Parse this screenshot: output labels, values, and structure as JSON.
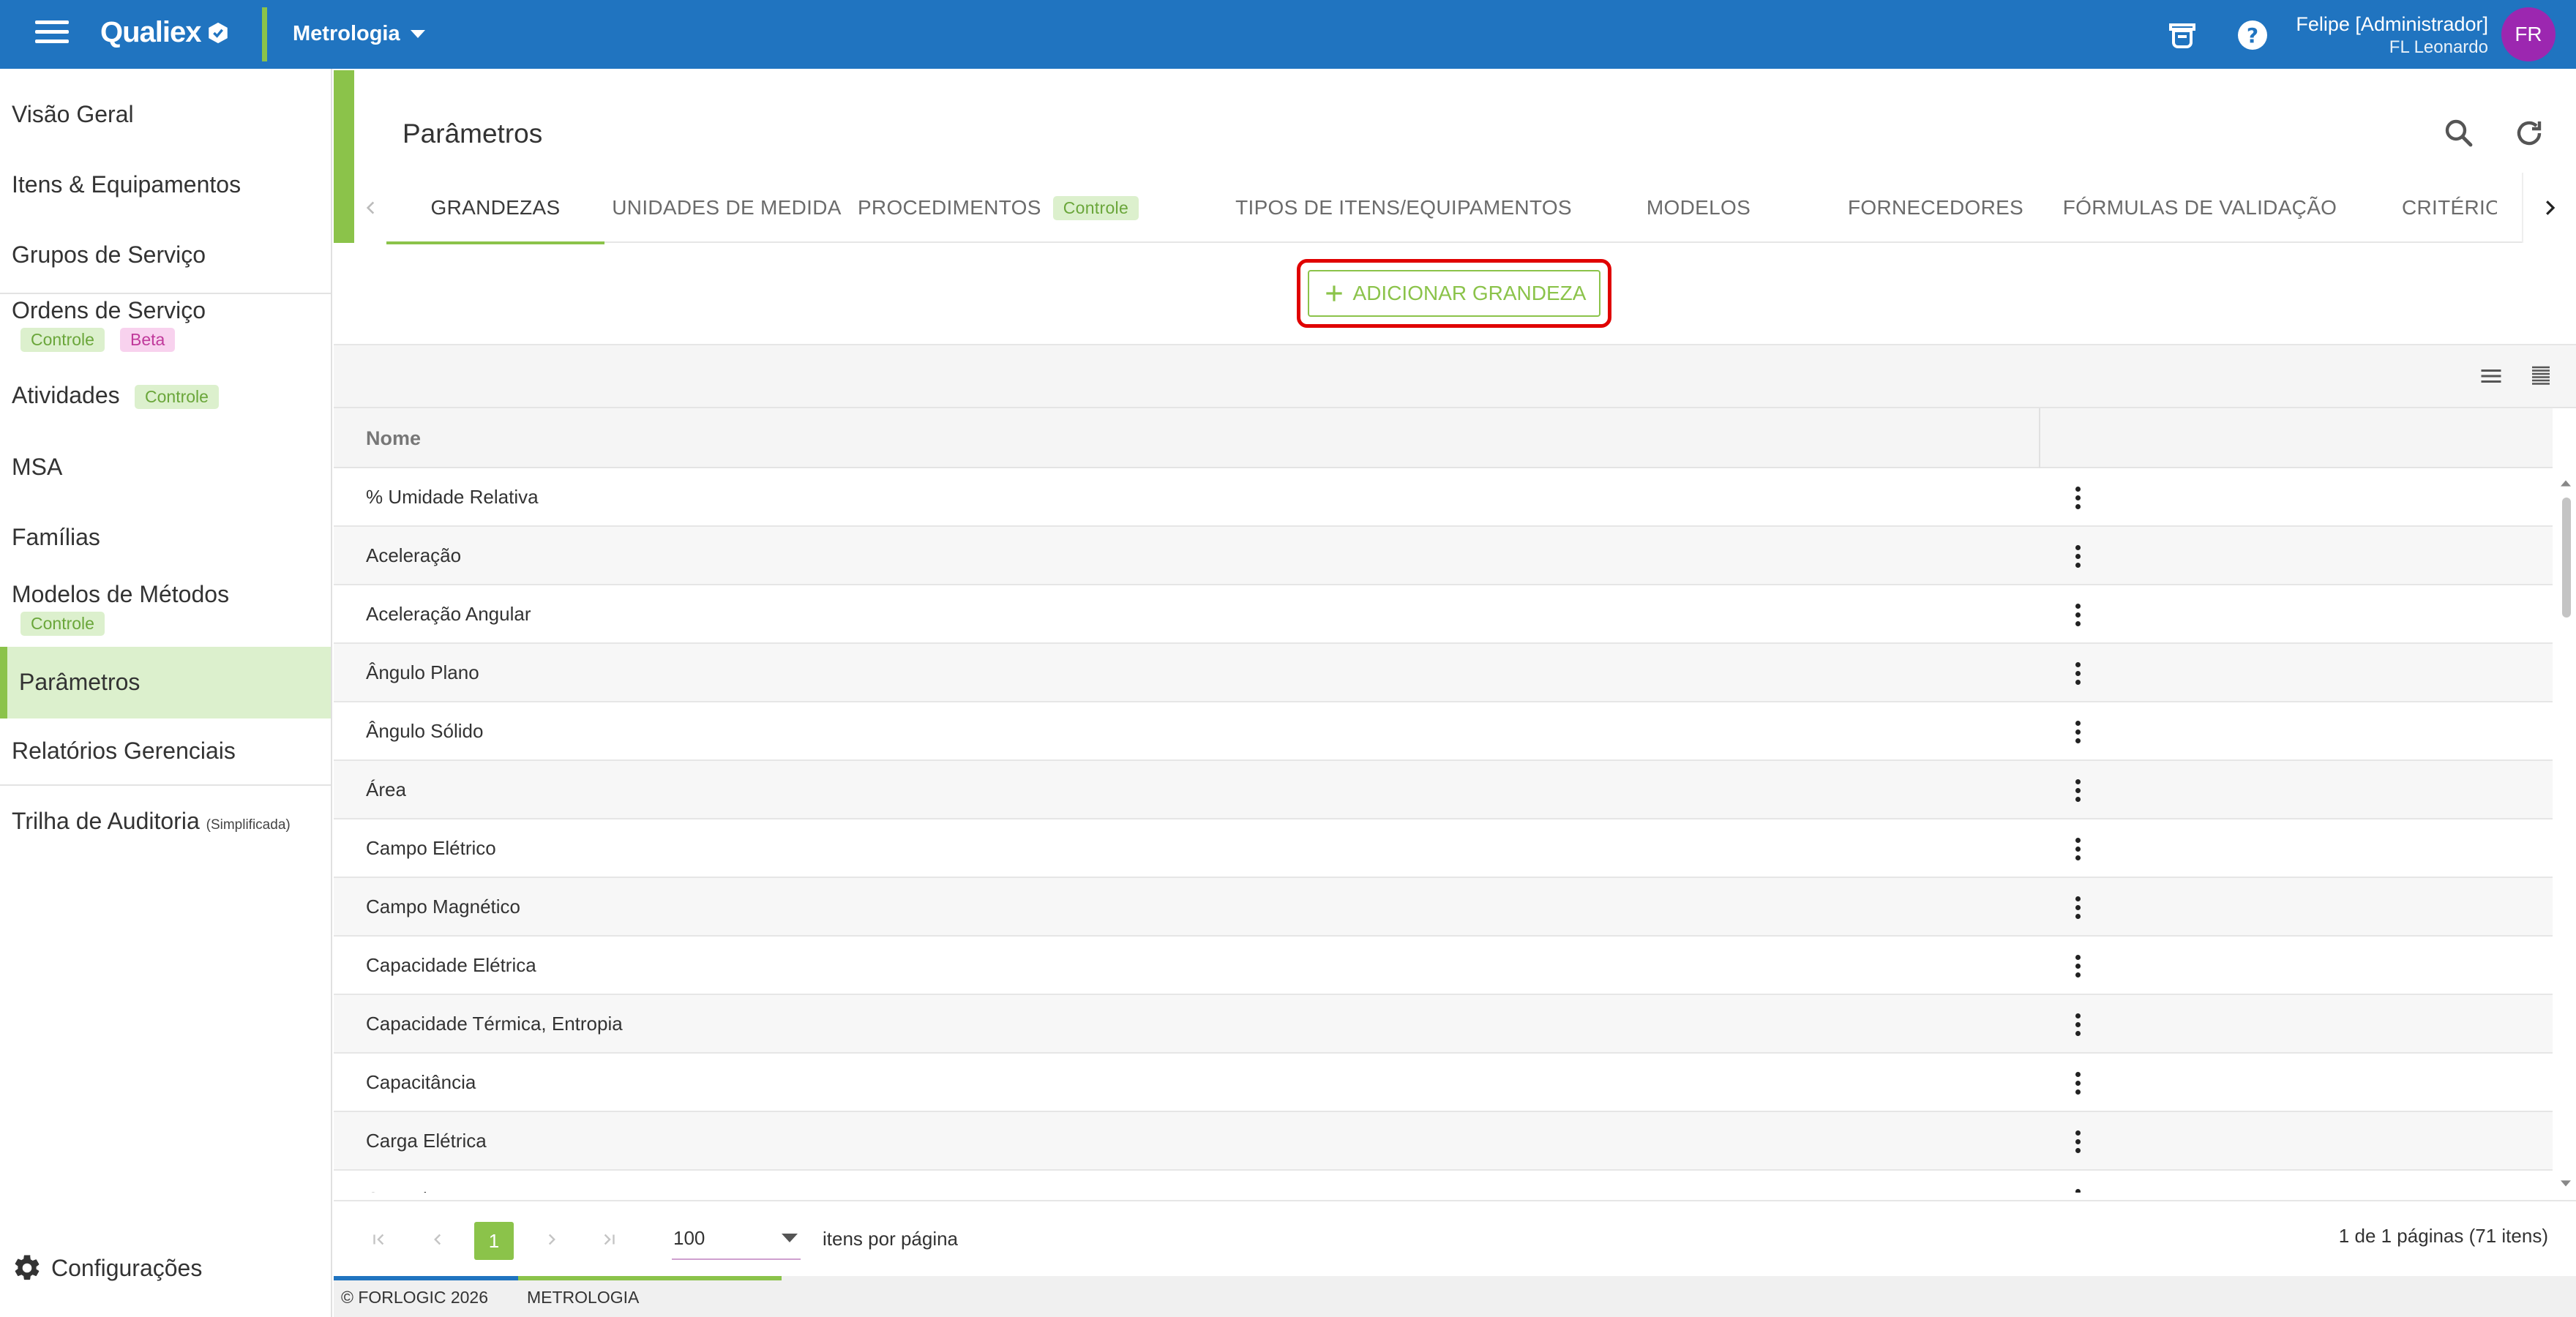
{
  "topbar": {
    "brand": "Qualiex",
    "module": "Metrologia",
    "user_name": "Felipe [Administrador]",
    "user_company": "FL Leonardo",
    "avatar_initials": "FR",
    "icons": [
      "menu-icon",
      "learning-icon",
      "help-icon"
    ]
  },
  "sidebar": {
    "items": [
      {
        "label": "Visão Geral"
      },
      {
        "label": "Itens & Equipamentos"
      },
      {
        "label": "Grupos de Serviço"
      },
      {
        "label": "Ordens de Serviço",
        "badges": [
          "Controle",
          "Beta"
        ]
      },
      {
        "label": "Atividades",
        "badges": [
          "Controle"
        ]
      },
      {
        "label": "MSA"
      },
      {
        "label": "Famílias"
      },
      {
        "label": "Modelos de Métodos",
        "badges": [
          "Controle"
        ]
      },
      {
        "label": "Parâmetros",
        "active": true
      },
      {
        "label": "Relatórios Gerenciais"
      },
      {
        "label": "Trilha de Auditoria",
        "suffix": "(Simplificada)"
      }
    ],
    "settings_label": "Configurações"
  },
  "page": {
    "title": "Parâmetros",
    "tabs": [
      {
        "label": "GRANDEZAS",
        "active": true
      },
      {
        "label": "UNIDADES DE MEDIDA"
      },
      {
        "label": "PROCEDIMENTOS",
        "badge": "Controle"
      },
      {
        "label": "TIPOS DE ITENS/EQUIPAMENTOS"
      },
      {
        "label": "MODELOS"
      },
      {
        "label": "FORNECEDORES"
      },
      {
        "label": "FÓRMULAS DE VALIDAÇÃO"
      },
      {
        "label": "CRITÉRIOS D"
      }
    ],
    "add_button": "ADICIONAR GRANDEZA"
  },
  "table": {
    "column_name": "Nome",
    "rows": [
      "% Umidade Relativa",
      "Aceleração",
      "Aceleração Angular",
      "Ângulo Plano",
      "Ângulo Sólido",
      "Área",
      "Campo Elétrico",
      "Campo Magnético",
      "Capacidade Elétrica",
      "Capacidade Térmica, Entropia",
      "Capacitância",
      "Carga Elétrica",
      "Comprimento"
    ]
  },
  "pager": {
    "current_page": "1",
    "per_page": "100",
    "per_page_label": "itens por página",
    "info": "1 de 1 páginas (71 itens)"
  },
  "footer": {
    "copyright": "© FORLOGIC 2026",
    "module": "METROLOGIA"
  },
  "colors": {
    "primary": "#2074c0",
    "accent": "#8bc34a",
    "highlight": "#e00000",
    "avatar": "#9c27b0"
  }
}
